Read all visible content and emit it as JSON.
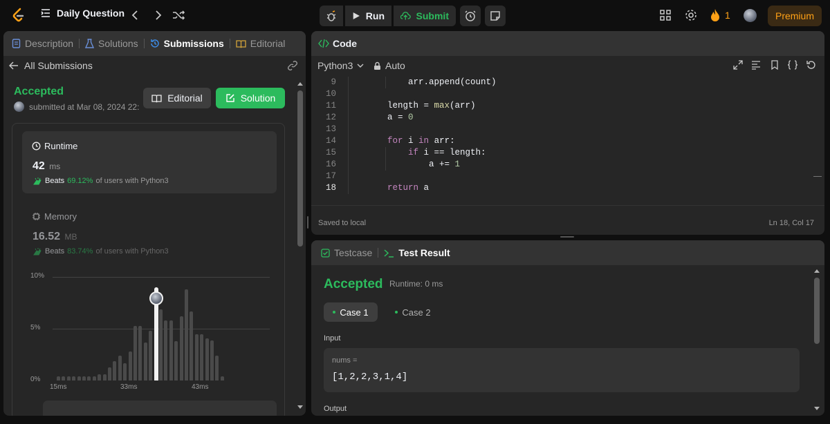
{
  "topbar": {
    "title": "Daily Question",
    "run_label": "Run",
    "submit_label": "Submit",
    "streak": "1",
    "premium_label": "Premium"
  },
  "left": {
    "tabs": [
      "Description",
      "Solutions",
      "Submissions",
      "Editorial"
    ],
    "back_label": "All Submissions",
    "status": "Accepted",
    "submitted": "submitted at Mar 08, 2024 22:",
    "editorial_btn": "Editorial",
    "solution_btn": "Solution",
    "runtime": {
      "title": "Runtime",
      "value": "42",
      "unit": "ms",
      "beats_label": "Beats",
      "beats_pct": "69.12%",
      "beats_suffix": "of users with Python3"
    },
    "memory": {
      "title": "Memory",
      "value": "16.52",
      "unit": "MB",
      "beats_label": "Beats",
      "beats_pct": "83.74%",
      "beats_suffix": "of users with Python3"
    },
    "chart_data": {
      "type": "bar",
      "y_ticks": [
        "10%",
        "5%",
        "0%"
      ],
      "x_ticks": [
        "15ms",
        "33ms",
        "43ms"
      ],
      "ylim": [
        0,
        10
      ],
      "values": [
        0.4,
        0.4,
        0.4,
        0.4,
        0.4,
        0.4,
        0.4,
        0.4,
        0.6,
        0.6,
        1.3,
        1.9,
        2.4,
        1.7,
        2.8,
        5.3,
        5.3,
        3.7,
        4.8,
        9.0,
        6.9,
        5.8,
        5.8,
        3.8,
        6.2,
        8.8,
        6.7,
        4.5,
        4.5,
        4.1,
        3.9,
        2.4,
        0.4
      ],
      "highlight_index": 19,
      "highlight_label": "43ms"
    }
  },
  "code": {
    "title": "Code",
    "language": "Python3",
    "autosave": "Auto",
    "lines": [
      {
        "n": "9",
        "text": "        arr.append(count)"
      },
      {
        "n": "10",
        "text": ""
      },
      {
        "n": "11",
        "text": "    length = max(arr)"
      },
      {
        "n": "12",
        "text": "    a = 0"
      },
      {
        "n": "13",
        "text": ""
      },
      {
        "n": "14",
        "text": "    for i in arr:"
      },
      {
        "n": "15",
        "text": "        if i == length:"
      },
      {
        "n": "16",
        "text": "            a += 1"
      },
      {
        "n": "17",
        "text": ""
      },
      {
        "n": "18",
        "text": "    return a"
      }
    ],
    "saved": "Saved to local",
    "position": "Ln 18, Col 17"
  },
  "result": {
    "tabs": [
      "Testcase",
      "Test Result"
    ],
    "status": "Accepted",
    "runtime": "Runtime: 0 ms",
    "cases": [
      "Case 1",
      "Case 2"
    ],
    "input_label": "Input",
    "var_label": "nums =",
    "var_value": "[1,2,2,3,1,4]",
    "output_label": "Output"
  },
  "colors": {
    "accent_green": "#2cbb5d",
    "premium": "#ffa116",
    "bg": "#0f0f0f",
    "panel": "#262626"
  }
}
